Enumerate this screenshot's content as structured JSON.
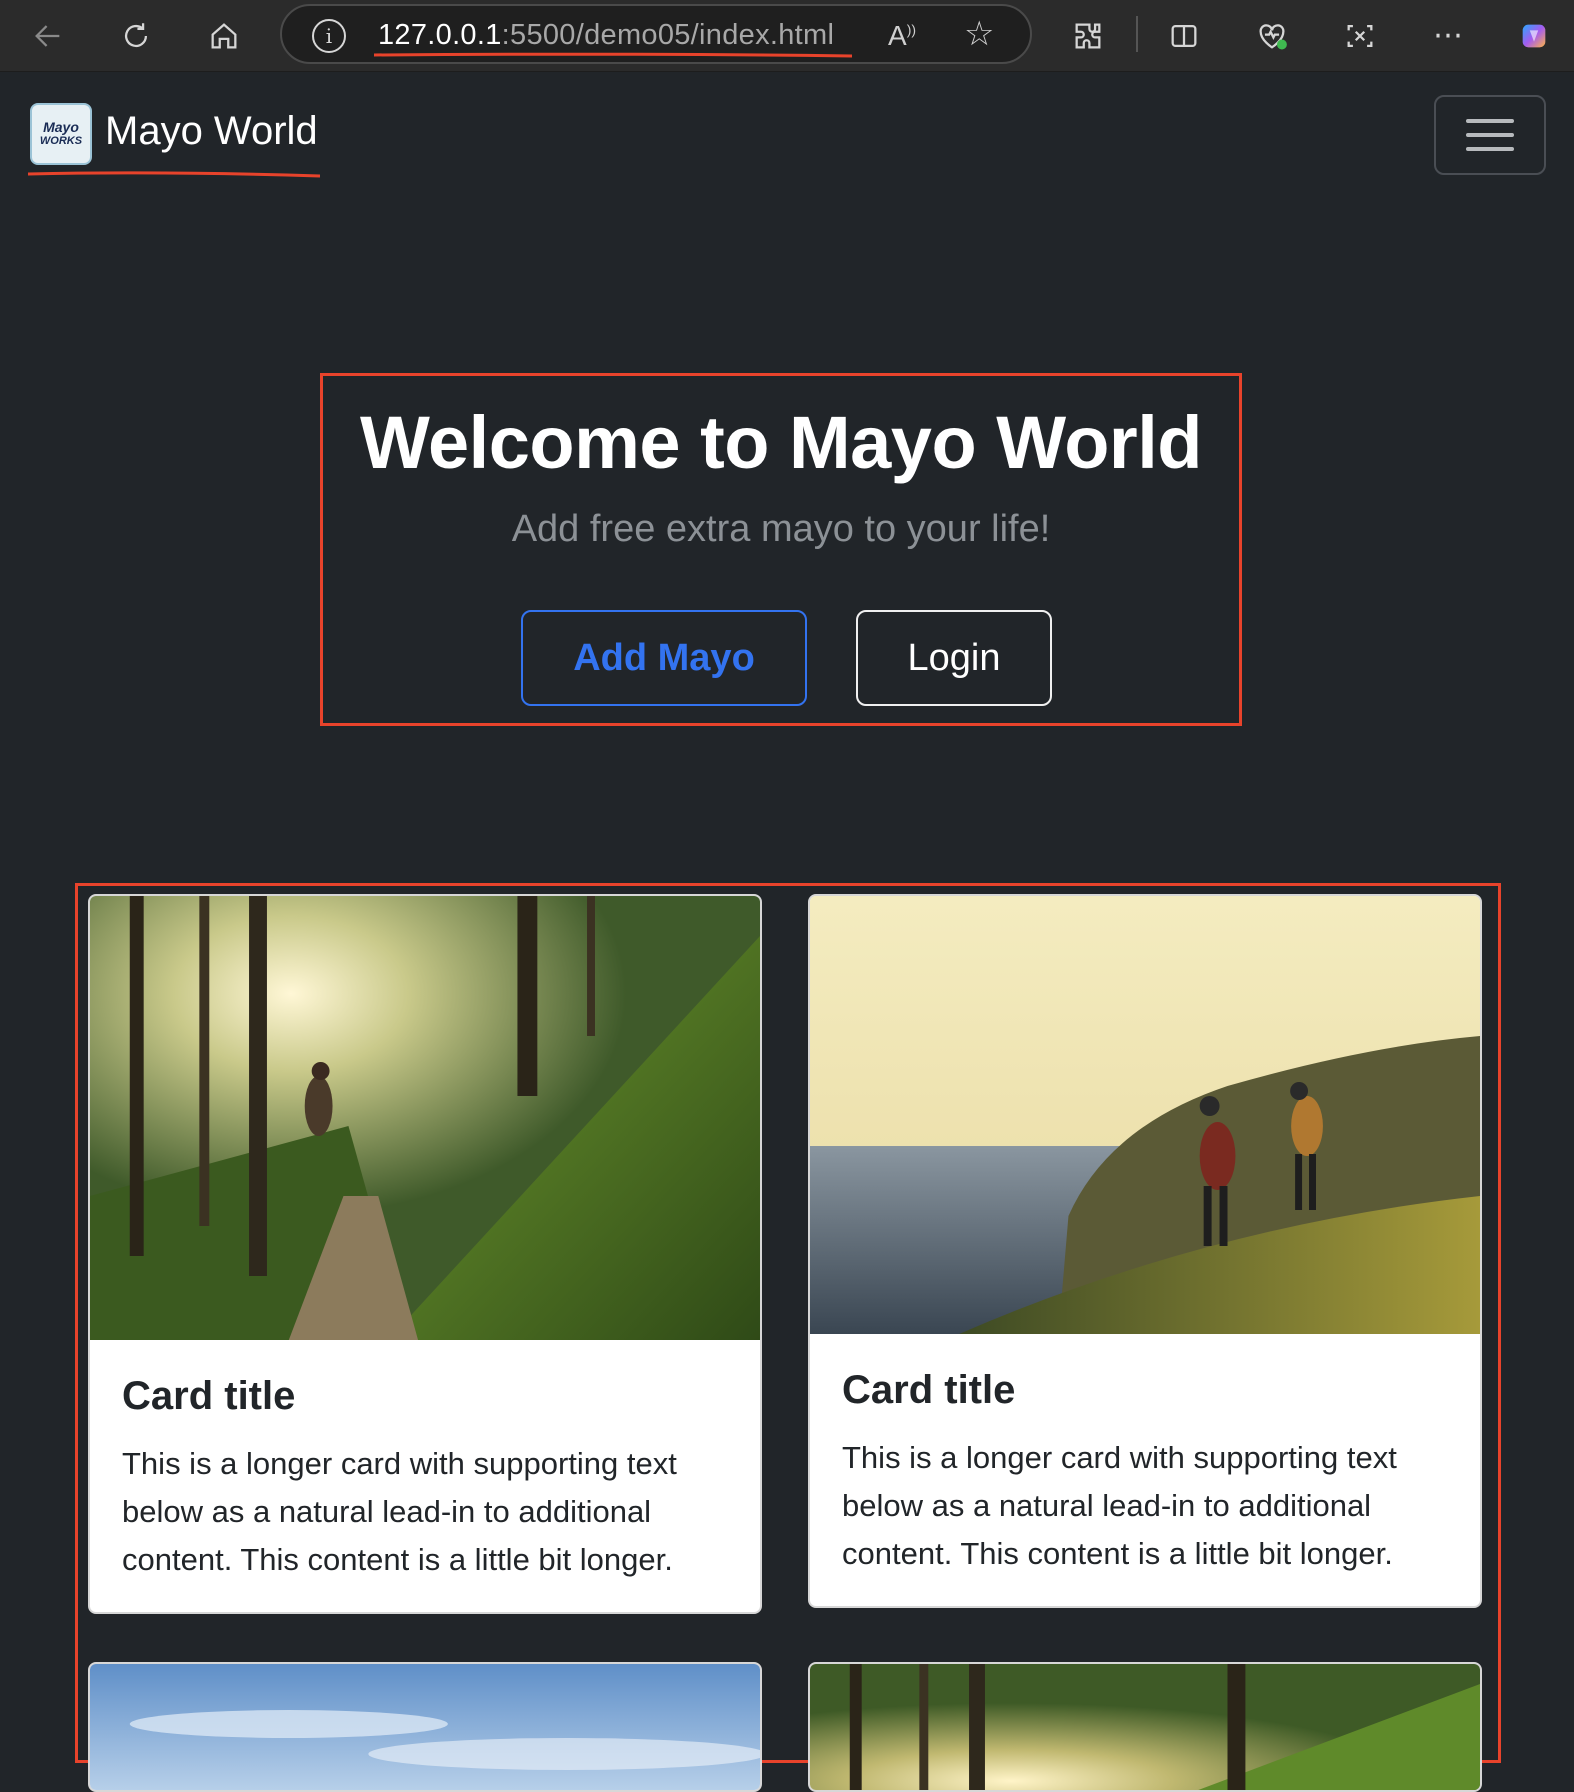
{
  "browser": {
    "url_host": "127.0.0.1",
    "url_path": ":5500/demo05/index.html"
  },
  "navbar": {
    "brand_logo_line1": "Mayo",
    "brand_logo_line2": "WORKS",
    "brand_name": "Mayo World"
  },
  "hero": {
    "title": "Welcome to Mayo World",
    "subtitle": "Add free extra mayo to your life!",
    "primary_button": "Add Mayo",
    "secondary_button": "Login"
  },
  "cards": [
    {
      "image": "forest-trail-hiker-photo",
      "title": "Card title",
      "text": "This is a longer card with supporting text below as a natural lead-in to additional content. This content is a little bit longer."
    },
    {
      "image": "coastal-hikers-sunset-photo",
      "title": "Card title",
      "text": "This is a longer card with supporting text below as a natural lead-in to additional content. This content is a little bit longer."
    },
    {
      "image": "sky-landscape-photo"
    },
    {
      "image": "forest-sunlight-photo"
    }
  ],
  "colors": {
    "page_background": "#212529",
    "primary_blue": "#3373f0",
    "annotation_red": "#e8432b"
  }
}
